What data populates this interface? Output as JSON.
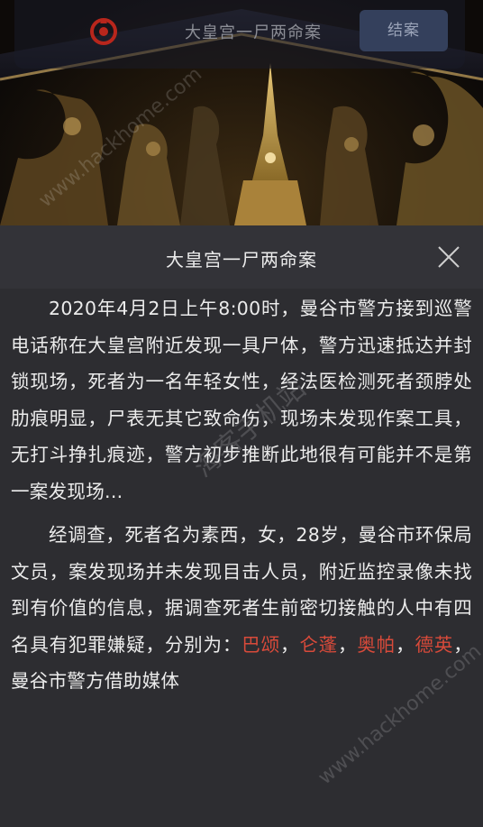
{
  "topbar": {
    "title": "大皇宫一尸两命案",
    "close_case_label": "结案"
  },
  "dialog": {
    "title": "大皇宫一尸两命案",
    "paragraph1": "2020年4月2日上午8:00时，曼谷市警方接到巡警电话称在大皇宫附近发现一具尸体，警方迅速抵达并封锁现场，死者为一名年轻女性，经法医检测死者颈脖处肋痕明显，尸表无其它致命伤，现场未发现作案工具，无打斗挣扎痕迹，警方初步推断此地很有可能并不是第一案发现场...",
    "paragraph2_intro": "经调查，死者名为素西，女，28岁，曼谷市环保局文员，案发现场并未发现目击人员，附近监控录像未找到有价值的信息，据调查死者生前密切接触的人中有四名具有犯罪嫌疑，分别为：",
    "suspects": [
      "巴颂",
      "仑蓬",
      "奥帕",
      "德英"
    ],
    "separator": "，",
    "paragraph2_outro": "，曼谷市警方借助媒体"
  },
  "watermark": {
    "text1": "www.hackhome.com",
    "text2": "海客手机站",
    "text3": "www.hackhome.com"
  },
  "colors": {
    "suspect_red": "#d84a3a",
    "dialog_bg": "#2d2d31",
    "button_bg": "#34405c"
  }
}
